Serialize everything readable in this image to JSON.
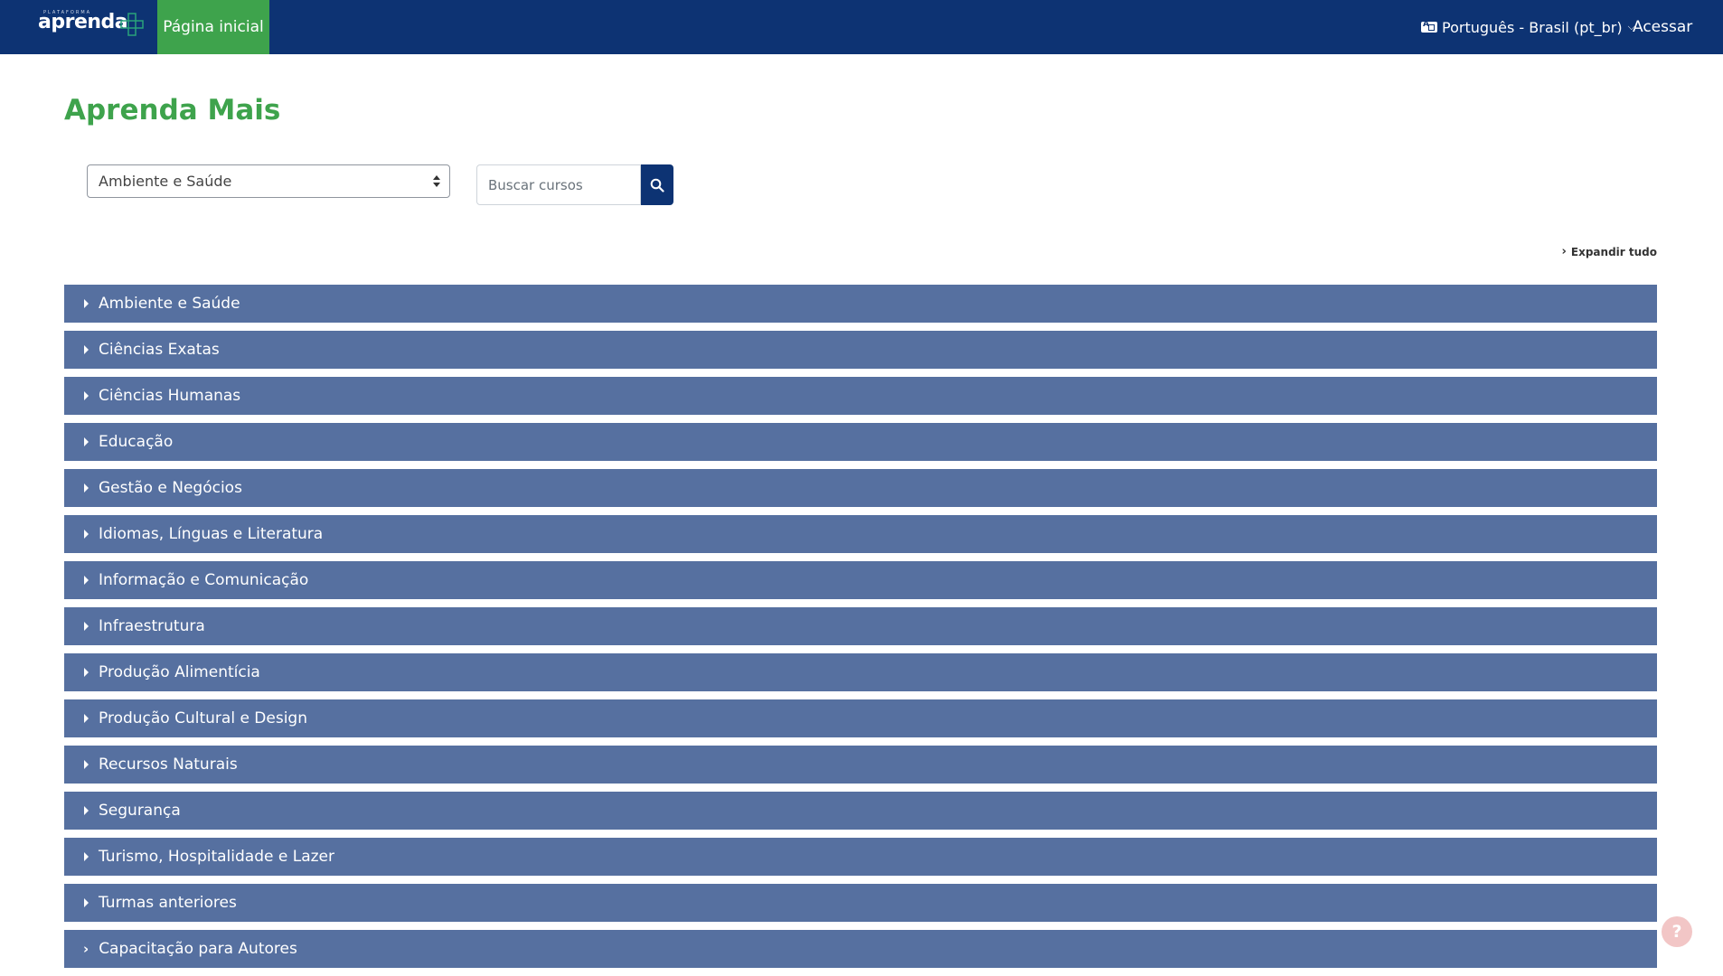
{
  "header": {
    "logo_top": "PLATAFORMA",
    "logo_brand": "aprenda",
    "nav_home": "Página inicial",
    "language": "Português - Brasil (pt_br)",
    "login": "Acessar"
  },
  "page": {
    "title": "Aprenda Mais"
  },
  "filters": {
    "selected_category": "Ambiente e Saúde",
    "search_placeholder": "Buscar cursos",
    "expand_all": "Expandir tudo"
  },
  "categories": [
    "Ambiente e Saúde",
    "Ciências Exatas",
    "Ciências Humanas",
    "Educação",
    "Gestão e Negócios",
    "Idiomas, Línguas e Literatura",
    "Informação e Comunicação",
    "Infraestrutura",
    "Produção Alimentícia",
    "Produção Cultural e Design",
    "Recursos Naturais",
    "Segurança",
    "Turismo, Hospitalidade e Lazer",
    "Turmas anteriores",
    "Capacitação para Autores"
  ],
  "help": "?",
  "colors": {
    "navbar": "#0d3373",
    "accent_green": "#3ea34c",
    "category_row": "#5670a0"
  }
}
